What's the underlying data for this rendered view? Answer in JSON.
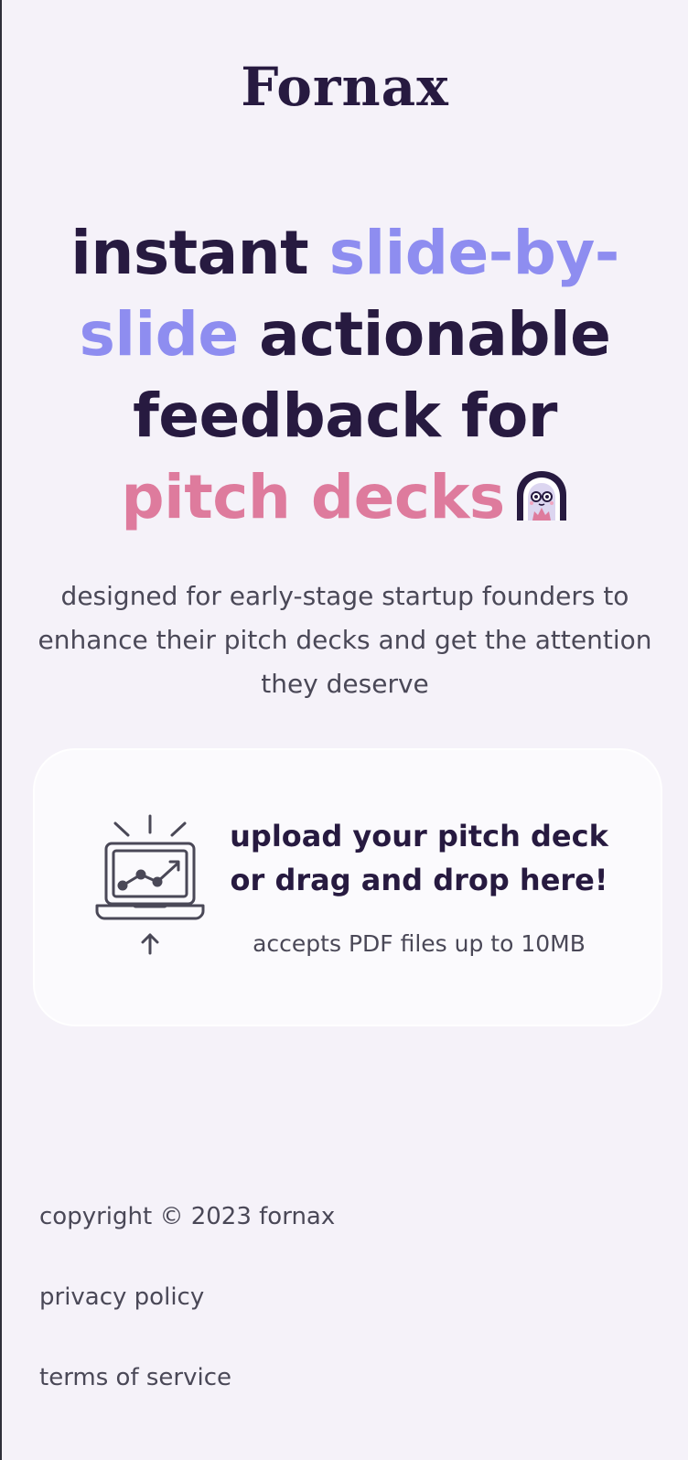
{
  "brand": {
    "logo_text": "Fornax"
  },
  "hero": {
    "headline": {
      "part1": "instant ",
      "part2": "slide-by-slide",
      "part3": " actionable feedback for ",
      "part4": "pitch decks"
    },
    "subtitle": "designed for early-stage startup founders to enhance their pitch decks and get the attention they deserve",
    "mascot_icon": "ghost-mascot-icon"
  },
  "upload": {
    "title": "upload your pitch deck or drag and drop here!",
    "note": "accepts PDF files up to 10MB",
    "icon": "laptop-chart-upload-icon"
  },
  "footer": {
    "copyright": "copyright © 2023 fornax",
    "privacy": "privacy policy",
    "terms": "terms of service"
  },
  "colors": {
    "background": "#f5f2f9",
    "text_dark": "#271a40",
    "accent_purple": "#8e8df0",
    "accent_pink": "#de7b9d",
    "text_muted": "#4a4857"
  }
}
